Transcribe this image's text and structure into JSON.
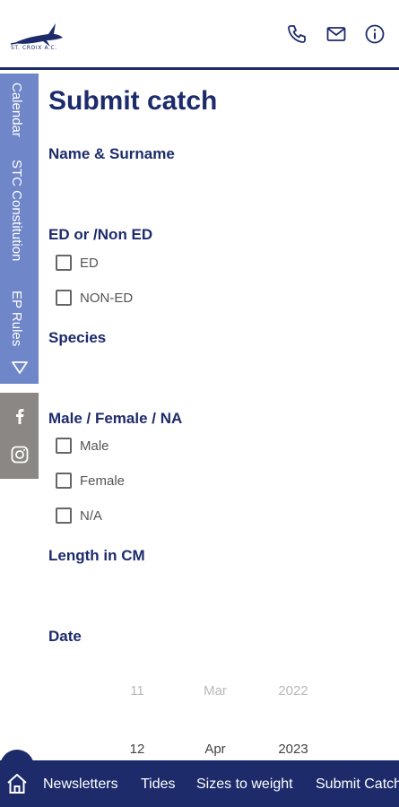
{
  "header": {
    "logo_text": "ST. CROIX A.C.",
    "icons": [
      "phone-icon",
      "mail-icon",
      "info-icon"
    ]
  },
  "side_nav": {
    "items": [
      {
        "label": "Calendar"
      },
      {
        "label": "STC Constitution"
      },
      {
        "label": "EP Rules"
      }
    ],
    "expand_icon": "triangle-down-icon",
    "social": [
      "facebook-icon",
      "instagram-icon"
    ]
  },
  "form": {
    "title": "Submit catch",
    "name_label": "Name & Surname",
    "ed_label": "ED or /Non ED",
    "ed_options": [
      "ED",
      "NON-ED"
    ],
    "species_label": "Species",
    "gender_label": "Male / Female / NA",
    "gender_options": [
      "Male",
      "Female",
      "N/A"
    ],
    "length_label": "Length in CM",
    "date_label": "Date",
    "date_wheel": {
      "day": [
        "11",
        "12"
      ],
      "month": [
        "Mar",
        "Apr"
      ],
      "year": [
        "2022",
        "2023"
      ]
    }
  },
  "bottom_nav": {
    "items": [
      {
        "label": "Newsletters"
      },
      {
        "label": "Tides"
      },
      {
        "label": "Sizes to weight"
      },
      {
        "label": "Submit Catch"
      }
    ]
  },
  "colors": {
    "primary": "#1d2b6b",
    "side_nav": "#6f86c9",
    "social_bg": "#8a8784"
  }
}
